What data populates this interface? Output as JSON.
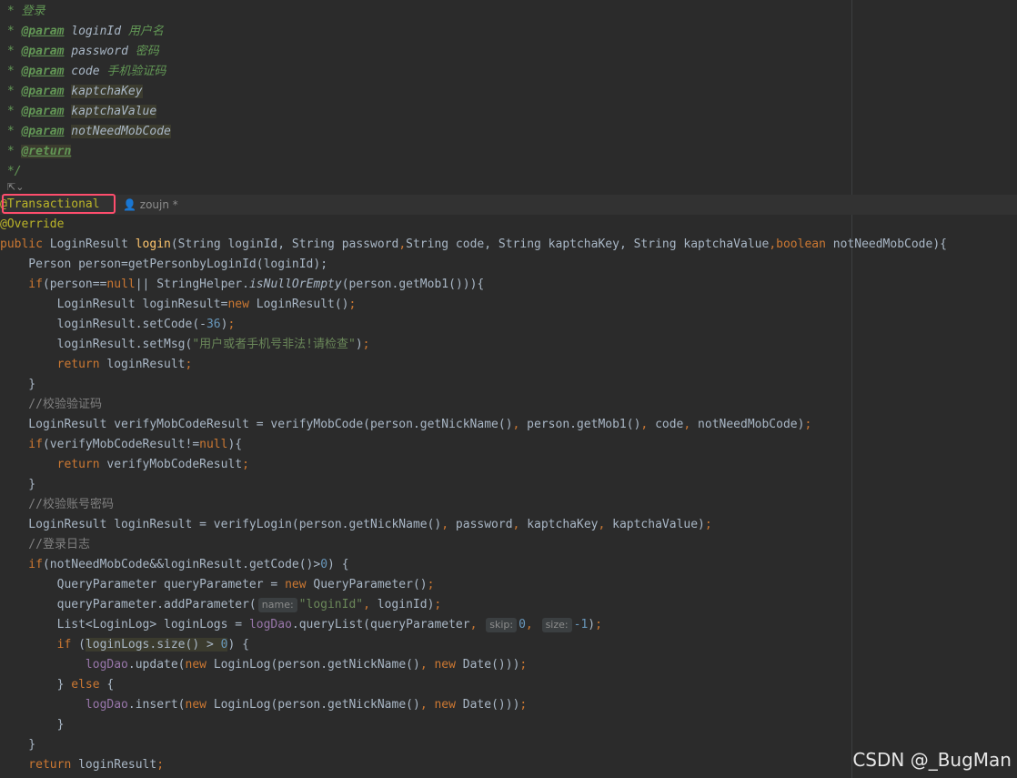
{
  "doc": {
    "l0_star": " * ",
    "l0_text": "登录",
    "l1_star": " * ",
    "l1_tag": "@param",
    "l1_name": "loginId",
    "l1_desc": "用户名",
    "l2_star": " * ",
    "l2_tag": "@param",
    "l2_name": "password",
    "l2_desc": "密码",
    "l3_star": " * ",
    "l3_tag": "@param",
    "l3_name": "code",
    "l3_desc": "手机验证码",
    "l4_star": " * ",
    "l4_tag": "@param",
    "l4_name": "kaptchaKey",
    "l5_star": " * ",
    "l5_tag": "@param",
    "l5_name": "kaptchaValue",
    "l6_star": " * ",
    "l6_tag": "@param",
    "l6_name": "notNeedMobCode",
    "l7_star": " * ",
    "l7_tag": "@return",
    "l8_end": " */"
  },
  "gutter": {
    "fold_icons": "⇱⌄"
  },
  "annotations": {
    "transactional": "@Transactional",
    "override": "@Override",
    "author": "zoujn *"
  },
  "code": {
    "sig_public": "public ",
    "sig_type": "LoginResult ",
    "sig_name": "login",
    "sig_params_a": "(String loginId, String password",
    "sig_comma1": ",",
    "sig_params_b": "String code, String kaptchaKey, String kaptchaValue",
    "sig_comma2": ",",
    "sig_bool": "boolean",
    "sig_params_c": " notNeedMobCode){",
    "l14": "    Person person=getPersonbyLoginId(loginId);",
    "l15_if": "    if",
    "l15_a": "(person==",
    "l15_null": "null",
    "l15_b": "|| StringHelper.",
    "l15_static": "isNullOrEmpty",
    "l15_c": "(person.getMob1())){",
    "l16_a": "        LoginResult loginResult=",
    "l16_new": "new",
    "l16_b": " LoginResult()",
    "l16_semi": ";",
    "l17_a": "        loginResult.setCode(-",
    "l17_num": "36",
    "l17_b": ")",
    "l17_semi": ";",
    "l18_a": "        loginResult.setMsg(",
    "l18_str": "\"用户或者手机号非法!请检查\"",
    "l18_b": ")",
    "l18_semi": ";",
    "l19_ret": "        return",
    "l19_a": " loginResult",
    "l19_semi": ";",
    "l20": "    }",
    "l21_cmt": "    //校验验证码",
    "l22_a": "    LoginResult verifyMobCodeResult = verifyMobCode(person.getNickName()",
    "l22_c1": ",",
    "l22_b": " person.getMob1()",
    "l22_c2": ",",
    "l22_c": " code",
    "l22_c3": ",",
    "l22_d": " notNeedMobCode)",
    "l22_semi": ";",
    "l23_if": "    if",
    "l23_a": "(verifyMobCodeResult!=",
    "l23_null": "null",
    "l23_b": "){",
    "l24_ret": "        return",
    "l24_a": " verifyMobCodeResult",
    "l24_semi": ";",
    "l25": "    }",
    "l26_cmt": "    //校验账号密码",
    "l27_a": "    LoginResult loginResult = verifyLogin(person.getNickName()",
    "l27_c1": ",",
    "l27_b": " password",
    "l27_c2": ",",
    "l27_c": " kaptchaKey",
    "l27_c3": ",",
    "l27_d": " kaptchaValue)",
    "l27_semi": ";",
    "l28_cmt": "    //登录日志",
    "l29_if": "    if",
    "l29_a": "(notNeedMobCode&&loginResult.getCode()>",
    "l29_num": "0",
    "l29_b": ") {",
    "l30_a": "        QueryParameter queryParameter = ",
    "l30_new": "new",
    "l30_b": " QueryParameter()",
    "l30_semi": ";",
    "l31_a": "        queryParameter.addParameter(",
    "l31_hint": "name:",
    "l31_str": "\"loginId\"",
    "l31_c": ",",
    "l31_b": " loginId)",
    "l31_semi": ";",
    "l32_a": "        List<LoginLog> loginLogs = ",
    "l32_field": "logDao",
    "l32_b": ".queryList(queryParameter",
    "l32_c1": ",",
    "l32_hint1": "skip:",
    "l32_num1": "0",
    "l32_c2": ",",
    "l32_hint2": "size:",
    "l32_num2": "-1",
    "l32_b2": ")",
    "l32_semi": ";",
    "l33_if": "        if",
    "l33_a": " (",
    "l33_expr": "loginLogs.size() > ",
    "l33_num": "0",
    "l33_b": ") {",
    "l34_field": "            logDao",
    "l34_a": ".update(",
    "l34_new": "new",
    "l34_b": " LoginLog(person.getNickName()",
    "l34_c": ",",
    "l34_new2": " new",
    "l34_d": " Date()))",
    "l34_semi": ";",
    "l35_a": "        } ",
    "l35_else": "else",
    "l35_b": " {",
    "l36_field": "            logDao",
    "l36_a": ".insert(",
    "l36_new": "new",
    "l36_b": " LoginLog(person.getNickName()",
    "l36_c": ",",
    "l36_new2": " new",
    "l36_d": " Date()))",
    "l36_semi": ";",
    "l37": "        }",
    "l38": "    }",
    "l39_ret": "    return",
    "l39_a": " loginResult",
    "l39_semi": ";"
  },
  "watermark": "CSDN @_BugMan"
}
